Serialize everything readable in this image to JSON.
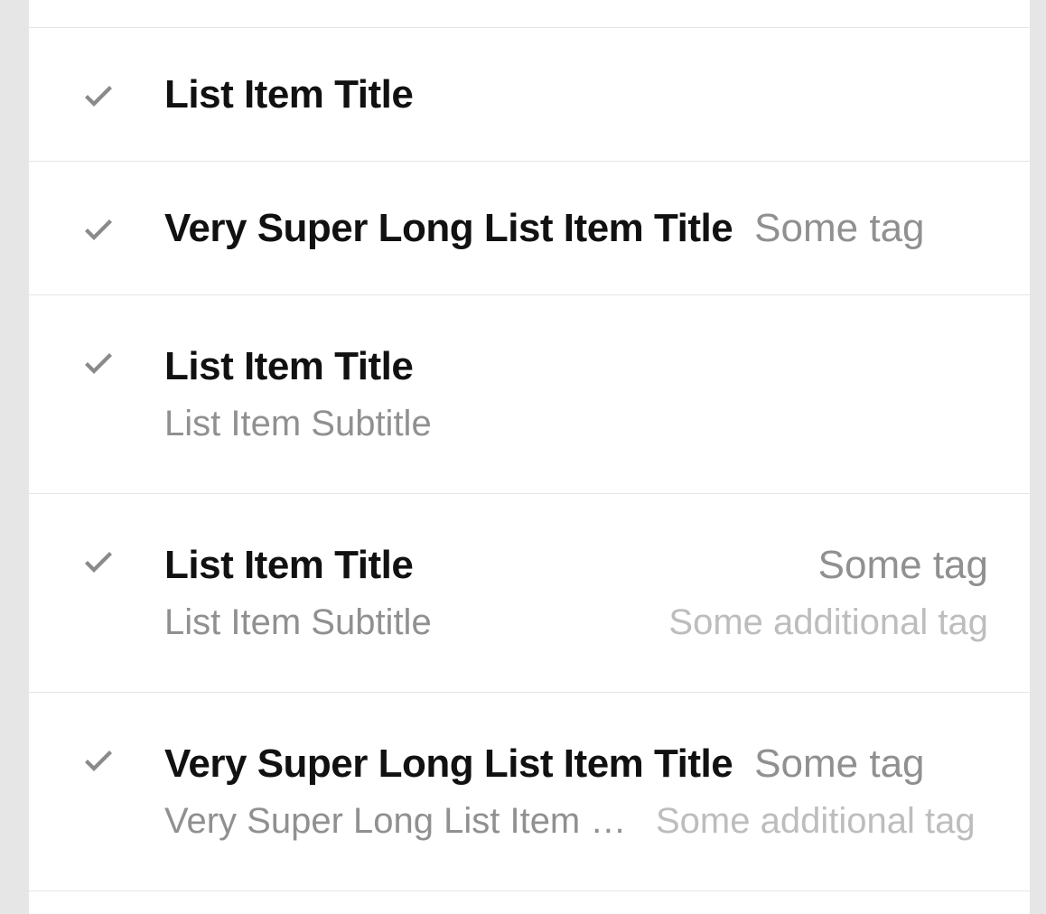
{
  "items": [
    {
      "title": "List Item Title"
    },
    {
      "title": "Very Super Long List Item Title",
      "tag": "Some tag",
      "tag_align": "inline"
    },
    {
      "title": "List Item Title",
      "subtitle": "List Item Subtitle"
    },
    {
      "title": "List Item Title",
      "tag": "Some tag",
      "tag_align": "right",
      "subtitle": "List Item Subtitle",
      "subtag": "Some additional tag",
      "subtag_align": "right"
    },
    {
      "title": "Very Super Long List Item Title",
      "tag": "Some tag",
      "tag_align": "inline",
      "subtitle": "Very Super Long List Item Subtitle",
      "subtag": "Some additional tag",
      "subtag_align": "inline"
    }
  ],
  "icon": "check-icon"
}
